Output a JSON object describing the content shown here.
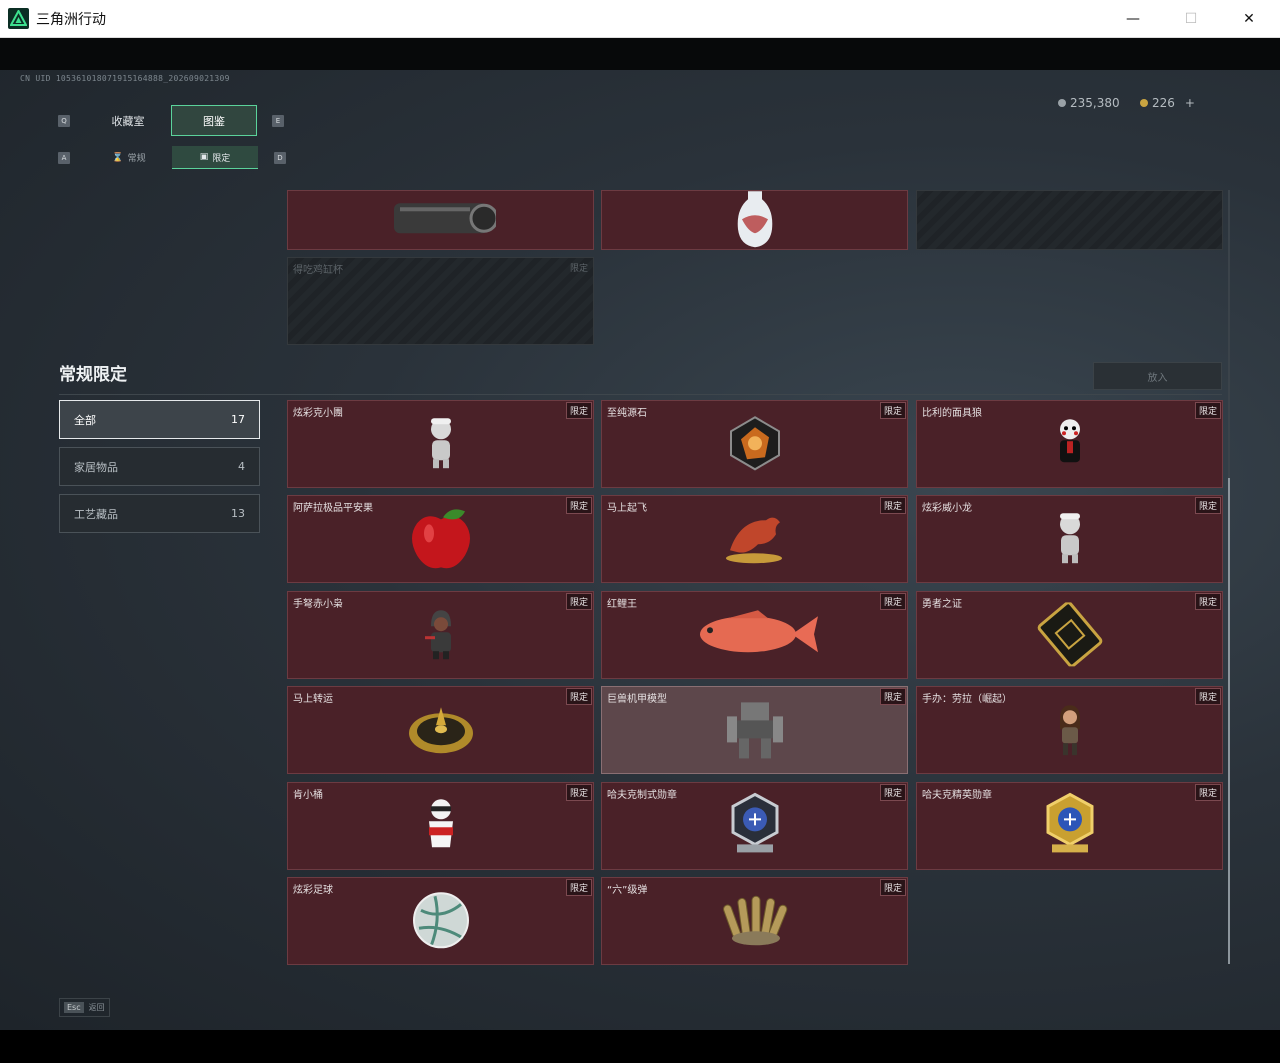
{
  "window": {
    "title": "三角洲行动",
    "minimize": "—",
    "maximize": "☐",
    "close": "✕"
  },
  "uid": "CN UID 105361018071915164888_202609021309",
  "currency": {
    "silver": "235,380",
    "gold": "226",
    "plus": "+"
  },
  "tabs": {
    "prev_key": "Q",
    "next_key": "E",
    "main": [
      {
        "label": "收藏室",
        "active": false
      },
      {
        "label": "图鉴",
        "active": true
      }
    ],
    "sub_prev_key": "A",
    "sub_next_key": "D",
    "sub": [
      {
        "label": "常规",
        "icon": "hourglass-icon",
        "active": false
      },
      {
        "label": "限定",
        "icon": "frame-icon",
        "active": true
      }
    ]
  },
  "upper_cells": [
    {
      "name": "",
      "tag": "",
      "art": "barrel",
      "empty": false
    },
    {
      "name": "",
      "tag": "",
      "art": "vase",
      "empty": false
    },
    {
      "name": "",
      "tag": "",
      "art": "",
      "empty": true
    },
    {
      "name": "得吃鸡缸杯",
      "tag": "限定",
      "art": "",
      "empty": true
    }
  ],
  "section": {
    "title": "常规限定",
    "put_button": "放入"
  },
  "filters": [
    {
      "label": "全部",
      "count": "17",
      "active": true
    },
    {
      "label": "家居物品",
      "count": "4",
      "active": false
    },
    {
      "label": "工艺藏品",
      "count": "13",
      "active": false
    }
  ],
  "items": [
    {
      "name": "炫彩克小團",
      "tag": "限定",
      "art": "figure-white"
    },
    {
      "name": "至纯源石",
      "tag": "限定",
      "art": "gem"
    },
    {
      "name": "比利的面具狼",
      "tag": "限定",
      "art": "puppet"
    },
    {
      "name": "阿萨拉极品平安果",
      "tag": "限定",
      "art": "apple"
    },
    {
      "name": "马上起飞",
      "tag": "限定",
      "art": "horse"
    },
    {
      "name": "炫彩威小龙",
      "tag": "限定",
      "art": "figure-white"
    },
    {
      "name": "手弩赤小枭",
      "tag": "限定",
      "art": "hooded"
    },
    {
      "name": "红鲤王",
      "tag": "限定",
      "art": "fish"
    },
    {
      "name": "勇者之证",
      "tag": "限定",
      "art": "card"
    },
    {
      "name": "马上转运",
      "tag": "限定",
      "art": "compass"
    },
    {
      "name": "巨兽机甲模型",
      "tag": "限定",
      "art": "mech",
      "hover": true
    },
    {
      "name": "手办：劳拉（崛起）",
      "tag": "限定",
      "art": "lara"
    },
    {
      "name": "肯小桶",
      "tag": "限定",
      "art": "mascot"
    },
    {
      "name": "哈夫克制式勋章",
      "tag": "限定",
      "art": "medal-silver"
    },
    {
      "name": "哈夫克精英勋章",
      "tag": "限定",
      "art": "medal-gold"
    },
    {
      "name": "炫彩足球",
      "tag": "限定",
      "art": "ball"
    },
    {
      "name": "“六”级弹",
      "tag": "限定",
      "art": "bullets"
    }
  ],
  "footer": {
    "esc_key": "Esc",
    "esc_label": "返回"
  }
}
